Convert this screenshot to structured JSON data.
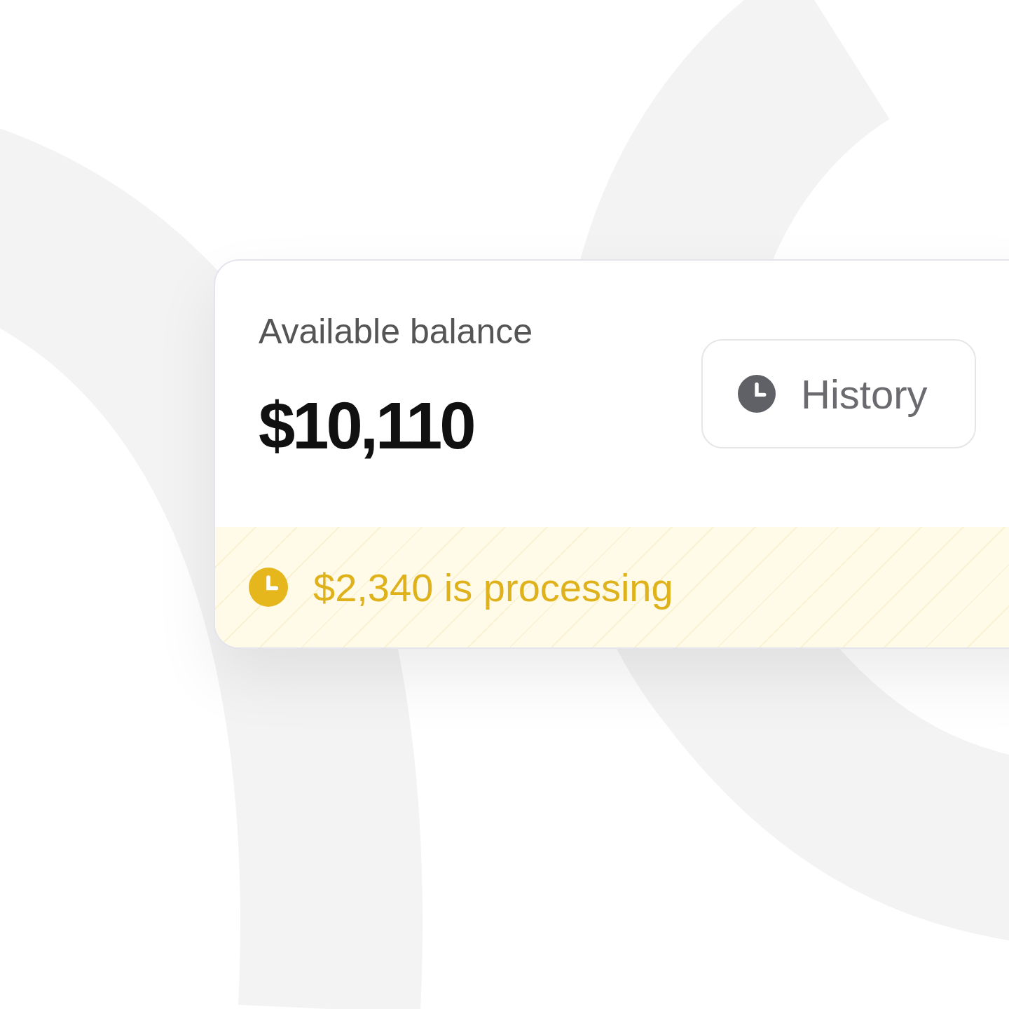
{
  "balance": {
    "label": "Available balance",
    "amount": "$10,110"
  },
  "history_button": {
    "label": "History"
  },
  "status": {
    "kind": "processing",
    "text": "$2,340 is processing"
  }
}
